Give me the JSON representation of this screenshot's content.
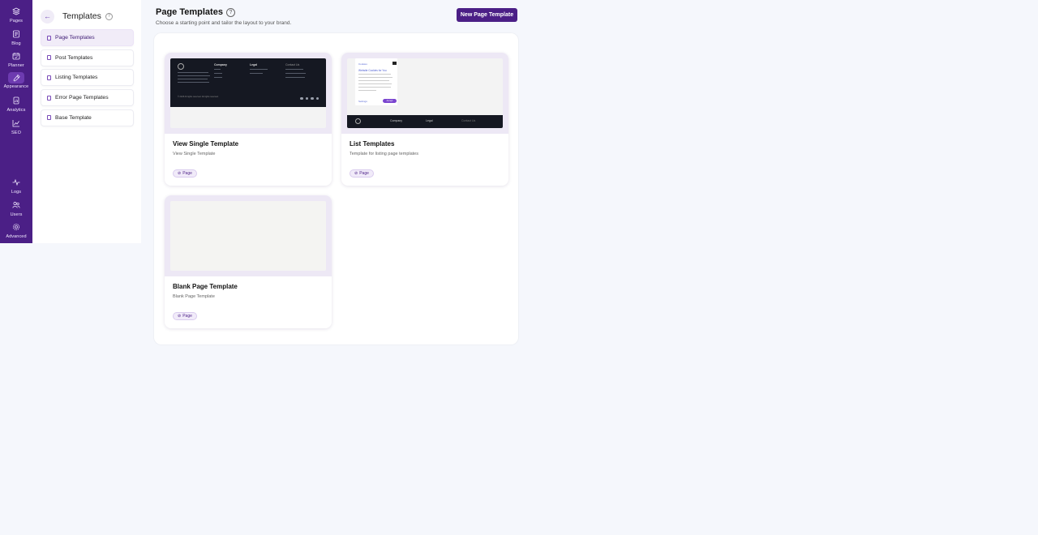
{
  "rail": [
    {
      "name": "pages",
      "label": "Pages",
      "icon": "layers-icon"
    },
    {
      "name": "blog",
      "label": "Blog",
      "icon": "blog-icon"
    },
    {
      "name": "planner",
      "label": "Planner",
      "icon": "calendar-icon"
    },
    {
      "name": "appearance",
      "label": "Appearance",
      "icon": "brush-icon",
      "active": true
    },
    {
      "name": "analytics",
      "label": "Analytics",
      "icon": "analytics-icon"
    },
    {
      "name": "seo",
      "label": "SEO",
      "icon": "chart-line-icon"
    },
    {
      "name": "logs",
      "label": "Logs",
      "icon": "activity-icon"
    },
    {
      "name": "users",
      "label": "Users",
      "icon": "users-icon"
    },
    {
      "name": "advanced",
      "label": "Advanced",
      "icon": "gear-icon"
    }
  ],
  "sidebar": {
    "title": "Templates",
    "help": "?",
    "back_icon": "←",
    "items": [
      {
        "label": "Page Templates",
        "active": true
      },
      {
        "label": "Post Templates"
      },
      {
        "label": "Listing Templates"
      },
      {
        "label": "Error Page Templates"
      },
      {
        "label": "Base Template"
      }
    ]
  },
  "main": {
    "title": "Page Templates",
    "help": "?",
    "subtitle": "Choose a starting point and tailor the layout to your brand.",
    "new_button": "New Page Template"
  },
  "cards": [
    {
      "title": "View Single Template",
      "desc": "View Single Template",
      "badge": "Page"
    },
    {
      "title": "List Templates",
      "desc": "Template for listing page templates",
      "badge": "Page"
    },
    {
      "title": "Blank Page Template",
      "desc": "Blank Page Template",
      "badge": "Page"
    }
  ],
  "thumb1": {
    "company": "Company",
    "legal": "Legal",
    "contact": "Contact Us",
    "copyright": "© 2025 All rights reserved. All rights reserved."
  },
  "thumb2": {
    "cookie_head": "Cookies",
    "cookie_title": "Website Cookies for You",
    "accept": "Accept",
    "settings": "Settings",
    "company": "Company",
    "legal": "Legal",
    "contact": "Contact Us"
  },
  "colors": {
    "brand": "#4b1f86",
    "rail_bg": "#4b1f86",
    "active_bg": "#f1ecf8"
  }
}
